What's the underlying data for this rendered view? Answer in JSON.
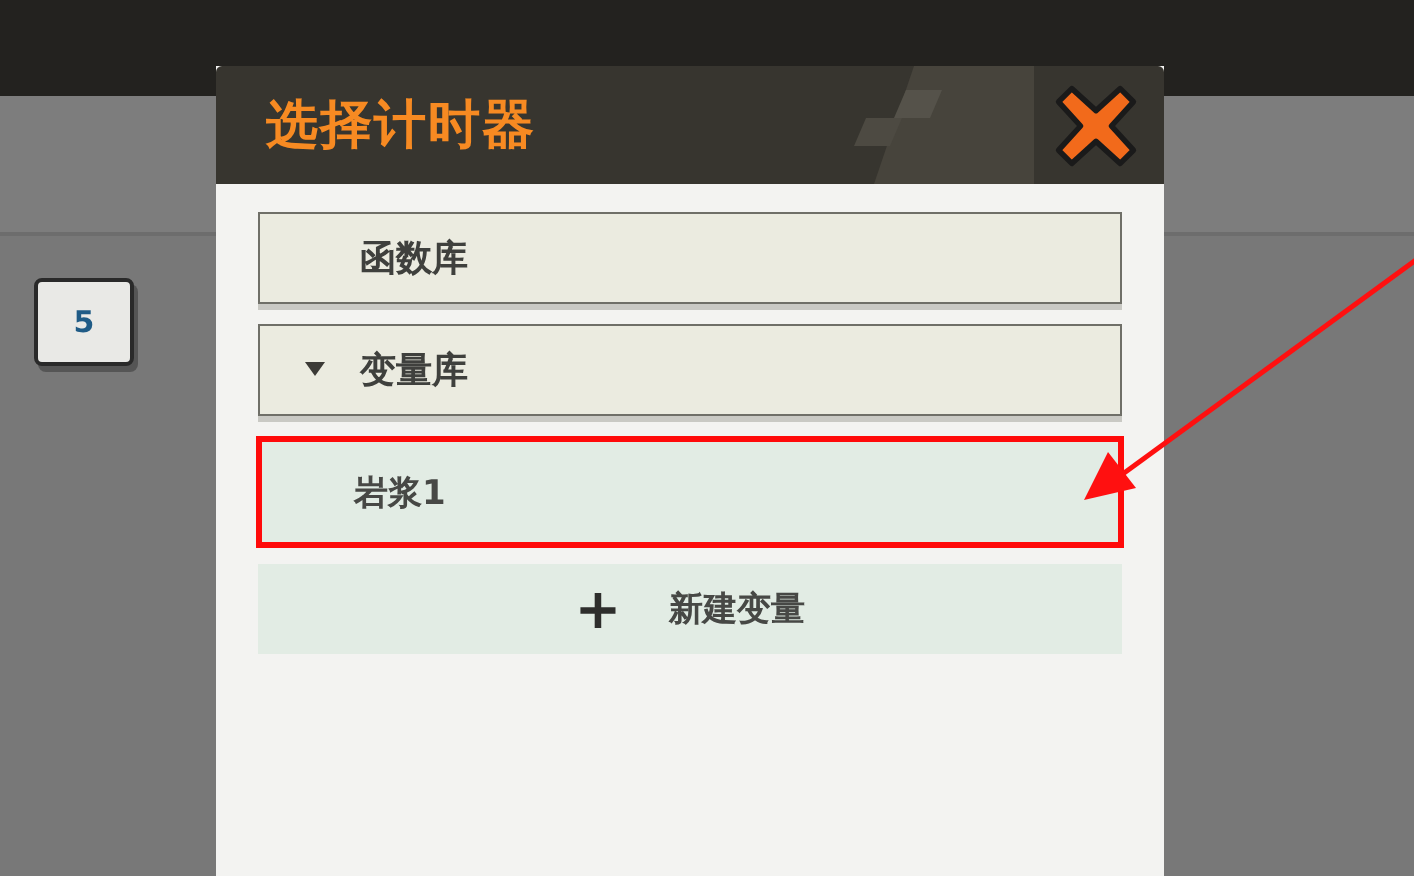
{
  "background": {
    "key": "5"
  },
  "dialog": {
    "title": "选择计时器",
    "sections": [
      {
        "label": "函数库",
        "kind": "plain"
      },
      {
        "label": "变量库",
        "kind": "folder",
        "expanded": true,
        "items": [
          {
            "label": "岩浆1",
            "highlighted": true
          }
        ]
      }
    ],
    "add_button": {
      "icon": "+",
      "label": "新建变量"
    }
  },
  "annotation": {
    "arrow": true
  }
}
